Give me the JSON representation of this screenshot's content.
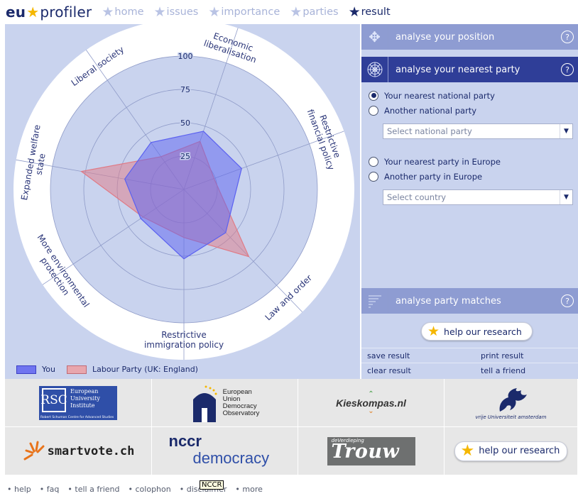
{
  "nav": {
    "logo_eu": "eu",
    "logo_profiler": "profiler",
    "items": [
      {
        "label": "home"
      },
      {
        "label": "issues"
      },
      {
        "label": "importance"
      },
      {
        "label": "parties"
      },
      {
        "label": "result"
      }
    ]
  },
  "chart_data": {
    "type": "radar",
    "axes": [
      "Economic liberalisation",
      "Restrictive financial policy",
      "Law and order",
      "Restrictive immigration policy",
      "More environmental protection",
      "Expanded welfare state",
      "Liberal society"
    ],
    "ticks": [
      "25",
      "50",
      "75",
      "100"
    ],
    "max": 100,
    "series": [
      {
        "name": "You",
        "color": "#5b61f0",
        "values": [
          46,
          46,
          45,
          52,
          39,
          45,
          43
        ]
      },
      {
        "name": "Labour Party (UK: England)",
        "color": "#e07a85",
        "values": [
          38,
          24,
          70,
          36,
          37,
          78,
          30
        ]
      }
    ]
  },
  "legend": {
    "you": "You",
    "labour": "Labour Party (UK: England)"
  },
  "right": {
    "analyse_position": "analyse your position",
    "analyse_nearest": "analyse your nearest party",
    "analyse_matches": "analyse party matches",
    "help_mark": "?",
    "opt_nearest_national": "Your nearest national  party",
    "opt_another_national": "Another national party",
    "select_national": "Select national party",
    "opt_nearest_europe": "Your nearest party in Europe",
    "opt_another_europe": "Another party in Europe",
    "select_country": "Select country",
    "help_research": "help our research",
    "save_result": "save result",
    "print_result": "print result",
    "clear_result": "clear result",
    "tell_friend": "tell a friend"
  },
  "logos": {
    "eui": [
      "European",
      "University",
      "Institute"
    ],
    "eui_sub": "Robert Schuman Centre for Advanced Studies",
    "eudo": [
      "European",
      "Union",
      "Democracy",
      "Observatory"
    ],
    "kieskompas": "Kieskompas.nl",
    "vu": "vrije Universiteit   amsterdam",
    "smartvote": "smartvote.ch",
    "nccr_top": "nccr",
    "nccr_bottom": "democracy",
    "trouw_small": "deVerdieping",
    "trouw": "Trouw",
    "help_research": "help our research"
  },
  "footer": {
    "items": [
      "help",
      "faq",
      "tell a friend",
      "colophon",
      "disclaimer",
      "more"
    ],
    "tooltip": "NCCR"
  }
}
